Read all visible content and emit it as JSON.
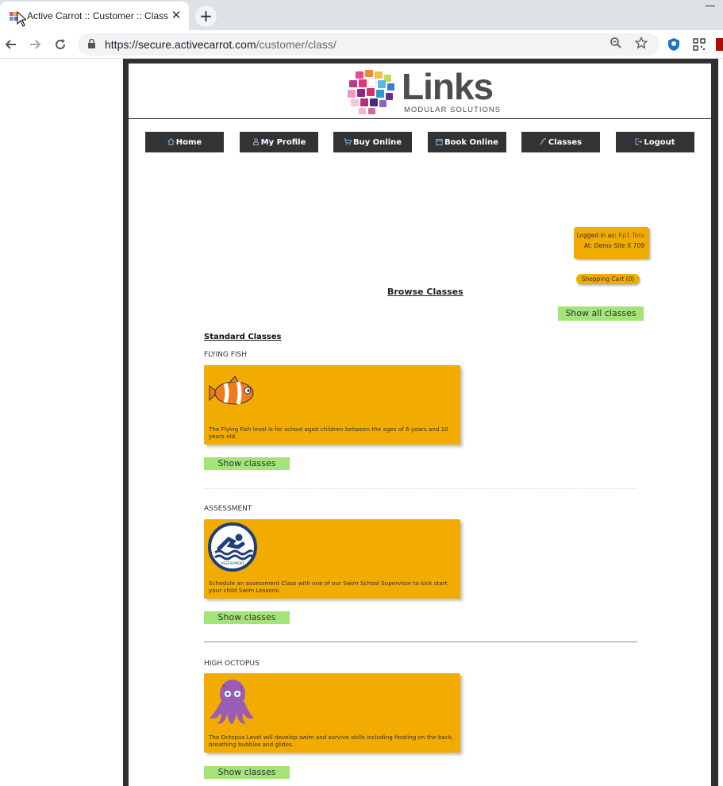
{
  "browser": {
    "tab_title": "Active Carrot :: Customer :: Class",
    "tab_close": "✕",
    "new_tab": "+",
    "url_host": "https://secure.activecarrot.com",
    "url_path": "/customer/class/"
  },
  "logo": {
    "word": "Links",
    "tagline": "MODULAR SOLUTIONS"
  },
  "nav": {
    "items": [
      {
        "label": "Home",
        "icon": "home-icon"
      },
      {
        "label": "My Profile",
        "icon": "person-icon"
      },
      {
        "label": "Buy Online",
        "icon": "cart-icon"
      },
      {
        "label": "Book Online",
        "icon": "calendar-icon"
      },
      {
        "label": "Classes",
        "icon": "swim-icon"
      },
      {
        "label": "Logout",
        "icon": "logout-icon"
      }
    ]
  },
  "session": {
    "logged_in_label": "Logged in as:",
    "user": "Rp1 Tess",
    "site_line": "At: Demo Site X 709",
    "cart": "Shopping Cart (0)"
  },
  "page": {
    "browse_title": "Browse Classes",
    "show_all": "Show all classes",
    "standard_title": "Standard Classes"
  },
  "classes": [
    {
      "name": "FLYING FISH",
      "image": "clownfish-icon",
      "description": "The Flying Fish level is for school aged children between the ages of 6 years and 10 years old.",
      "button": "Show classes"
    },
    {
      "name": "ASSESSMENT",
      "image": "swimmer-assessment-icon",
      "badge_text": "ASSESSMENT",
      "description": "Schedule an assessment Class with one of our Swim School Supervisor to kick start your child Swim Lessons.",
      "button": "Show classes"
    },
    {
      "name": "HIGH OCTOPUS",
      "image": "octopus-icon",
      "description": "The Octopus Level will develop swim and survive skills including floating on the back, breathing bubbles and glides.",
      "button": "Show classes"
    }
  ],
  "colors": {
    "card": "#f2ab00",
    "button_green": "#a3e37a",
    "nav_dark": "#333333",
    "frame": "#303030"
  }
}
